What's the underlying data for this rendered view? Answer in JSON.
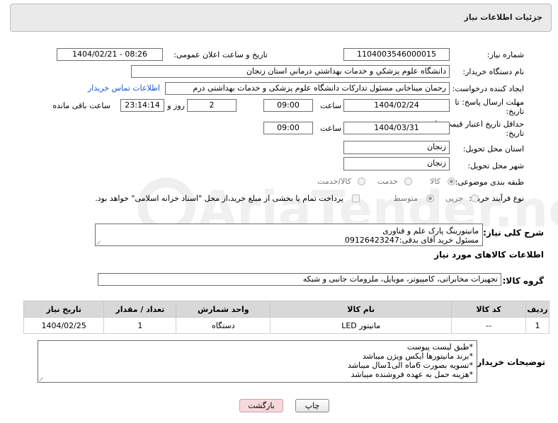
{
  "header": {
    "title": "جزئیات اطلاعات نیاز"
  },
  "fields": {
    "need_number_label": "شماره نیاز:",
    "need_number": "1104003546000015",
    "announce_label": "تاریخ و ساعت اعلان عمومی:",
    "announce_value": "1404/02/21 - 08:26",
    "buyer_org_label": "نام دستگاه خریدار:",
    "buyer_org": "دانشگاه علوم پزشکي و خدمات بهداشتي  درماني استان زنجان",
    "creator_label": "ایجاد کننده درخواست:",
    "creator": "رحمان میناخانی مسئول تدارکات دانشگاه علوم پزشکی و خدمات بهداشتی  درم",
    "contact_link": "اطلاعات تماس خریدار",
    "reply_deadline_label": "مهلت ارسال پاسخ: تا تاریخ:",
    "reply_date": "1404/02/24",
    "time_label": "ساعت",
    "reply_time": "09:00",
    "days_value": "2",
    "days_label": "روز و",
    "remaining_value": "23:14:14",
    "remaining_label": "ساعت باقی مانده",
    "validity_label": "حداقل تاریخ اعتبار قیمت: تا تاریخ:",
    "validity_date": "1404/03/31",
    "validity_time": "09:00",
    "province_label": "استان محل تحویل:",
    "province": "زنجان",
    "city_label": "شهر محل تحویل:",
    "city": "زنجان",
    "category_label": "طبقه بندی موضوعی:",
    "category_options": [
      "کالا",
      "خدمت",
      "کالا/خدمت"
    ],
    "purchase_type_label": "نوع فرآیند خرید :",
    "purchase_options": [
      "جزیی",
      "متوسط"
    ],
    "payment_note": "پرداخت تمام یا بخشی از مبلغ خرید،از محل \"اسناد خزانه اسلامی\" خواهد بود.",
    "description_label": "شرح کلی نیاز:",
    "description_lines": [
      "مانیتورینگ پارک علم و فناوری",
      "مسئول خرید آقای بدقی:09126423247"
    ],
    "goods_info_title": "اطلاعات کالاهای مورد نیاز",
    "goods_group_label": "گروه کالا:",
    "goods_group": "تجهیزات مخابراتی، کامپیوتر، موبایل، ملزومات جانبی و شبکه"
  },
  "table": {
    "headers": [
      "ردیف",
      "کد کالا",
      "نام کالا",
      "واحد شمارش",
      "تعداد / مقدار",
      "تاریخ نیاز"
    ],
    "rows": [
      [
        "1",
        "--",
        "مانیتور LED",
        "دستگاه",
        "1",
        "1404/02/25"
      ]
    ]
  },
  "buyer_notes": {
    "label": "توضیحات خریدار:",
    "lines": [
      "*طبق لیست پیوست",
      "*برند مانیتورها ایکس ویژن میباشد",
      "*تسویه بصورت 6ماه الی1سال میباشد",
      "*هزینه حمل به عهده فروشنده میباشد"
    ]
  },
  "buttons": {
    "print": "چاپ",
    "back": "بازگشت"
  },
  "watermark": {
    "text": "AriaTender.net"
  }
}
